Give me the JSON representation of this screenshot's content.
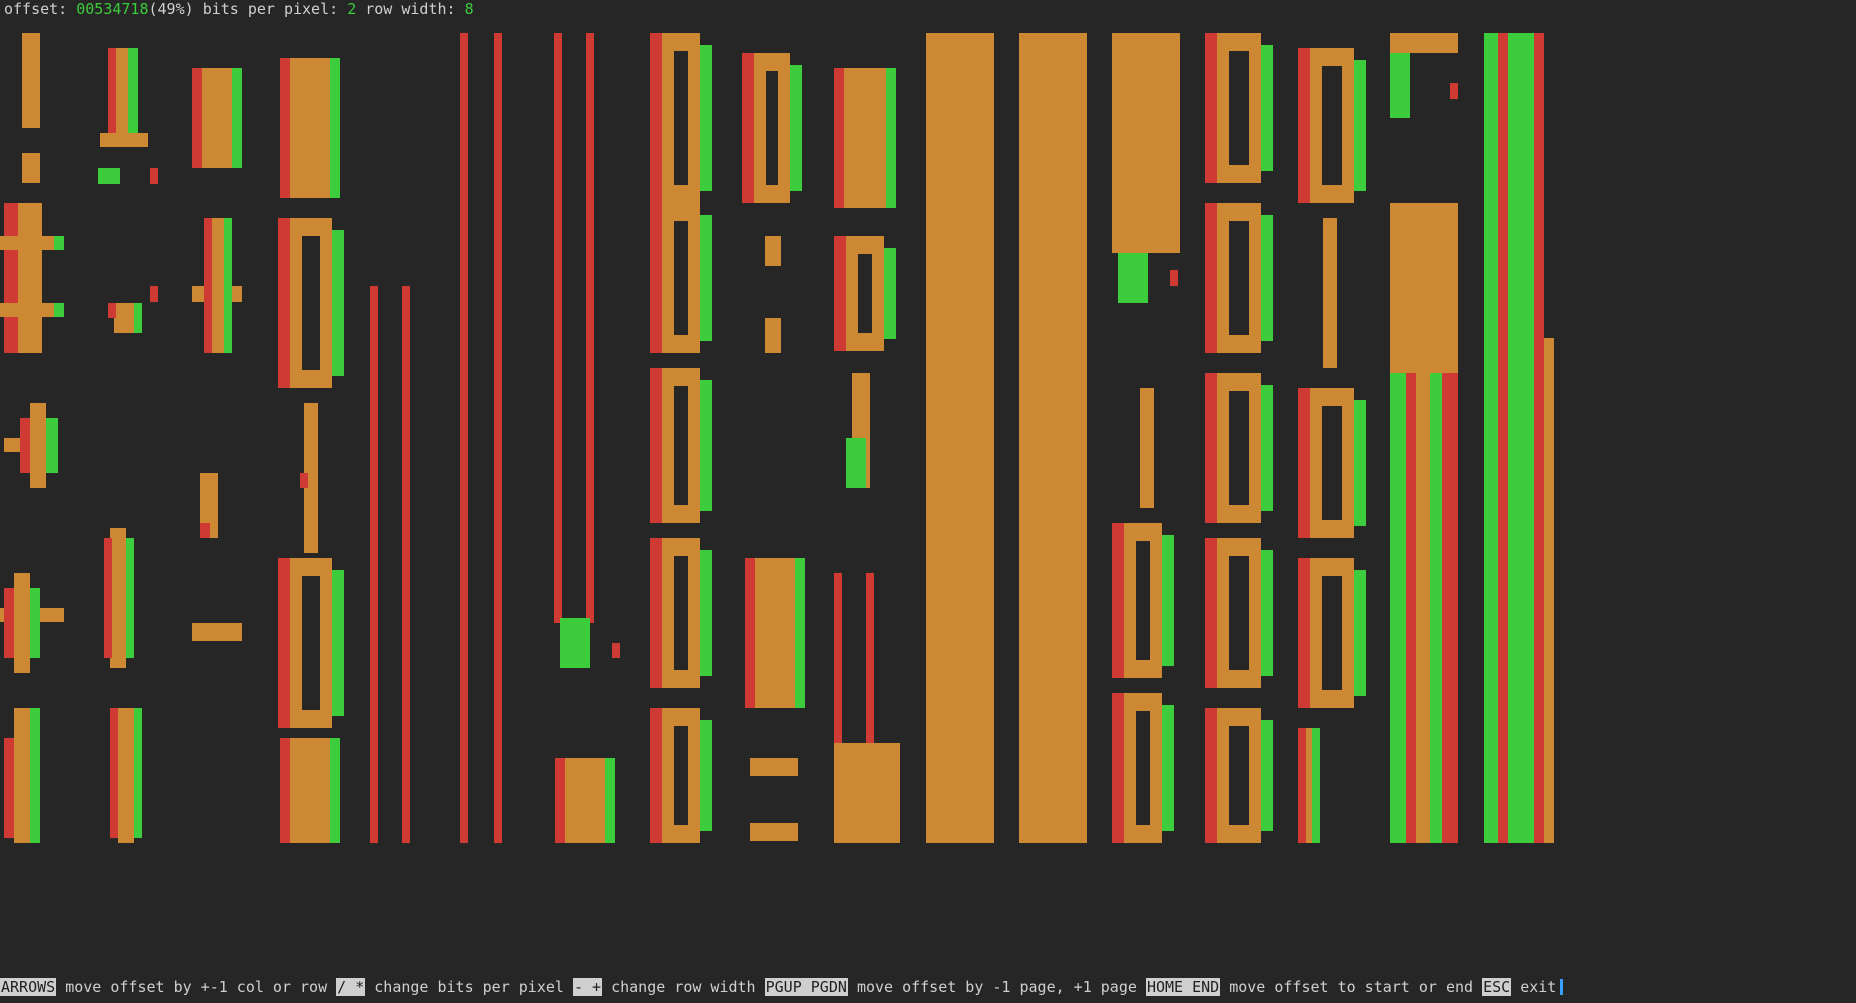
{
  "status_bar": {
    "offset_label": "offset:",
    "offset_value": "00534718",
    "offset_percent": "(49%)",
    "bpp_label": "bits per pixel:",
    "bpp_value": "2",
    "row_width_label": "row width:",
    "row_width_value": "8"
  },
  "palette": {
    "background": "#262626",
    "color_1": "#d03a34",
    "color_2": "#3ccc3c",
    "color_3": "#cc8833"
  },
  "help_bar": {
    "items": [
      {
        "key": "ARROWS",
        "text": "move offset by +-1 col or row"
      },
      {
        "key": "/ *",
        "text": "change bits per pixel"
      },
      {
        "key": "- +",
        "text": "change row width"
      },
      {
        "key": "PGUP PGDN",
        "text": "move offset by -1 page, +1 page"
      },
      {
        "key": "HOME END",
        "text": "move offset to start or end"
      },
      {
        "key": "ESC",
        "text": "exit"
      }
    ]
  }
}
